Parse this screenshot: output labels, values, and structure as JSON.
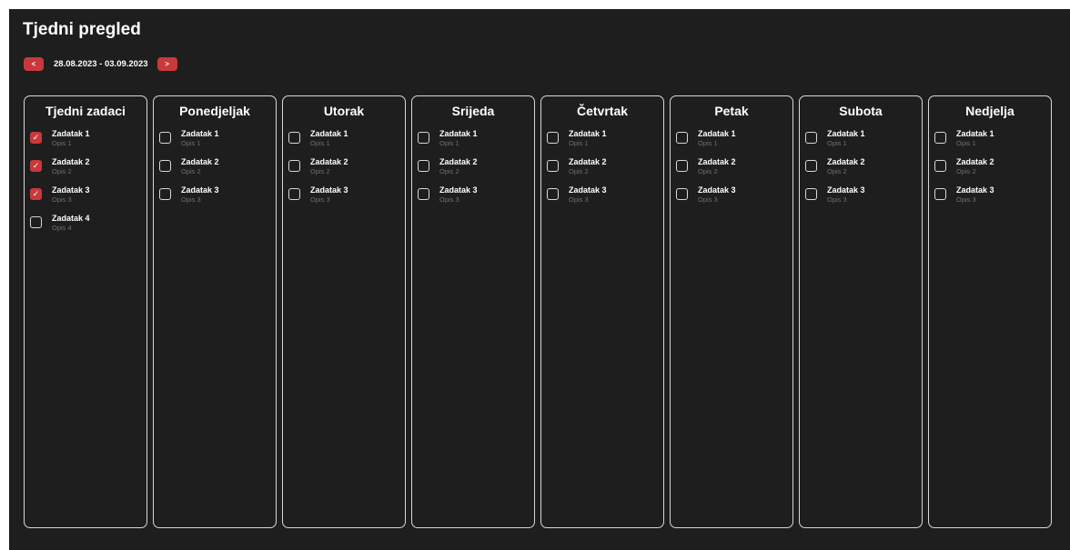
{
  "page": {
    "title": "Tjedni pregled"
  },
  "week_nav": {
    "prev_label": "<",
    "range": "28.08.2023 - 03.09.2023",
    "next_label": ">"
  },
  "colors": {
    "background": "#1e1e1e",
    "accent": "#c9393c",
    "border": "#d8d8d8",
    "muted_text": "#6f6f6f"
  },
  "columns": [
    {
      "title": "Tjedni zadaci",
      "tasks": [
        {
          "name": "Zadatak 1",
          "desc": "Opis 1",
          "checked": true
        },
        {
          "name": "Zadatak 2",
          "desc": "Opis 2",
          "checked": true
        },
        {
          "name": "Zadatak 3",
          "desc": "Opis 3",
          "checked": true
        },
        {
          "name": "Zadatak 4",
          "desc": "Opis 4",
          "checked": false
        }
      ]
    },
    {
      "title": "Ponedjeljak",
      "tasks": [
        {
          "name": "Zadatak 1",
          "desc": "Opis 1",
          "checked": false
        },
        {
          "name": "Zadatak 2",
          "desc": "Opis 2",
          "checked": false
        },
        {
          "name": "Zadatak 3",
          "desc": "Opis 3",
          "checked": false
        }
      ]
    },
    {
      "title": "Utorak",
      "tasks": [
        {
          "name": "Zadatak 1",
          "desc": "Opis 1",
          "checked": false
        },
        {
          "name": "Zadatak 2",
          "desc": "Opis 2",
          "checked": false
        },
        {
          "name": "Zadatak 3",
          "desc": "Opis 3",
          "checked": false
        }
      ]
    },
    {
      "title": "Srijeda",
      "tasks": [
        {
          "name": "Zadatak 1",
          "desc": "Opis 1",
          "checked": false
        },
        {
          "name": "Zadatak 2",
          "desc": "Opis 2",
          "checked": false
        },
        {
          "name": "Zadatak 3",
          "desc": "Opis 3",
          "checked": false
        }
      ]
    },
    {
      "title": "Četvrtak",
      "tasks": [
        {
          "name": "Zadatak 1",
          "desc": "Opis 1",
          "checked": false
        },
        {
          "name": "Zadatak 2",
          "desc": "Opis 2",
          "checked": false
        },
        {
          "name": "Zadatak 3",
          "desc": "Opis 3",
          "checked": false
        }
      ]
    },
    {
      "title": "Petak",
      "tasks": [
        {
          "name": "Zadatak 1",
          "desc": "Opis 1",
          "checked": false
        },
        {
          "name": "Zadatak 2",
          "desc": "Opis 2",
          "checked": false
        },
        {
          "name": "Zadatak 3",
          "desc": "Opis 3",
          "checked": false
        }
      ]
    },
    {
      "title": "Subota",
      "tasks": [
        {
          "name": "Zadatak 1",
          "desc": "Opis 1",
          "checked": false
        },
        {
          "name": "Zadatak 2",
          "desc": "Opis 2",
          "checked": false
        },
        {
          "name": "Zadatak 3",
          "desc": "Opis 3",
          "checked": false
        }
      ]
    },
    {
      "title": "Nedjelja",
      "tasks": [
        {
          "name": "Zadatak 1",
          "desc": "Opis 1",
          "checked": false
        },
        {
          "name": "Zadatak 2",
          "desc": "Opis 2",
          "checked": false
        },
        {
          "name": "Zadatak 3",
          "desc": "Opis 3",
          "checked": false
        }
      ]
    }
  ]
}
